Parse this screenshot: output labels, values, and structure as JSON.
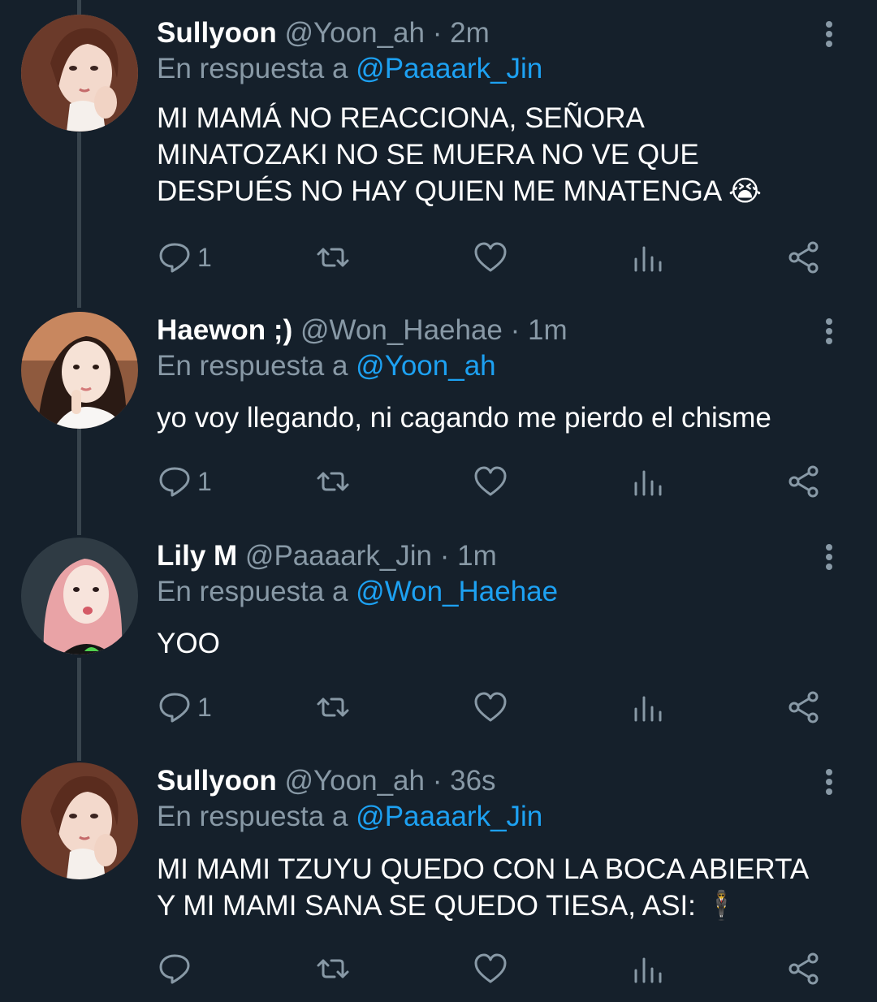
{
  "reply_label": "En respuesta a",
  "tweets": [
    {
      "display_name": "Sullyoon",
      "handle": "@Yoon_ah",
      "separator": "·",
      "time": "2m",
      "reply_to": "@Paaaark_Jin",
      "text_lines": [
        "MI MAMÁ NO REACCIONA, SEÑORA",
        "MINATOZAKI NO SE MUERA NO VE QUE",
        "DESPUÉS NO HAY QUIEN ME MNATENGA 😭"
      ],
      "reply_count": "1",
      "avatar": "sullyoon-avatar"
    },
    {
      "display_name": "Haewon ;)",
      "handle": "@Won_Haehae",
      "separator": "·",
      "time": "1m",
      "reply_to": "@Yoon_ah",
      "text_lines": [
        "yo voy llegando, ni cagando me pierdo el chisme"
      ],
      "reply_count": "1",
      "avatar": "haewon-avatar"
    },
    {
      "display_name": "Lily M",
      "handle": "@Paaaark_Jin",
      "separator": "·",
      "time": "1m",
      "reply_to": "@Won_Haehae",
      "text_lines": [
        "YOO"
      ],
      "reply_count": "1",
      "avatar": "lily-avatar"
    },
    {
      "display_name": "Sullyoon",
      "handle": "@Yoon_ah",
      "separator": "·",
      "time": "36s",
      "reply_to": "@Paaaark_Jin",
      "text_lines": [
        "MI MAMI TZUYU QUEDO CON LA BOCA ABIERTA",
        "Y MI MAMI SANA SE QUEDO TIESA, ASI: 🕴"
      ],
      "reply_count": "",
      "avatar": "sullyoon-avatar"
    }
  ],
  "icons": {
    "reply": "reply-icon",
    "retweet": "retweet-icon",
    "like": "like-icon",
    "analytics": "analytics-icon",
    "share": "share-icon",
    "more": "more-icon"
  },
  "colors": {
    "background": "#15202b",
    "text": "#ffffff",
    "secondary": "#8899a6",
    "link": "#1da1f2",
    "thread_line": "#38444d"
  }
}
